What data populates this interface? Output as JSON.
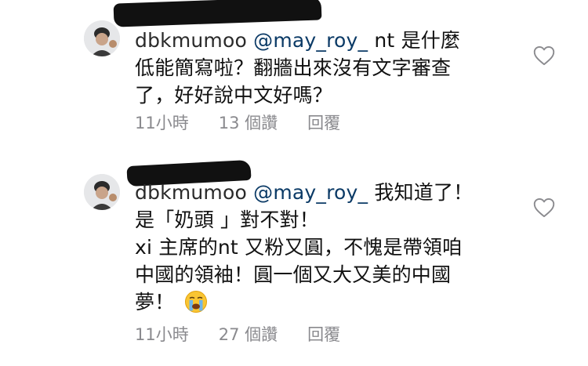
{
  "comments": [
    {
      "username": "dbkmumoo",
      "mention": "@may_roy_",
      "lines": [
        "nt 是什麼",
        "低能簡寫啦？翻牆出來沒有文字審查",
        "了，好好說中文好嗎？"
      ],
      "time": "11小時",
      "likes": "13 個讚",
      "reply": "回覆"
    },
    {
      "username": "dbkmumoo",
      "mention": "@may_roy_",
      "lines": [
        "我知道了！",
        "是「奶頭 」對不對！",
        "xi 主席的nt 又粉又圓，不愧是帶領咱",
        "中國的領袖！圓一個又大又美的中國",
        "夢！"
      ],
      "emoji": "crying-face-icon",
      "time": "11小時",
      "likes": "27 個讚",
      "reply": "回覆"
    }
  ]
}
